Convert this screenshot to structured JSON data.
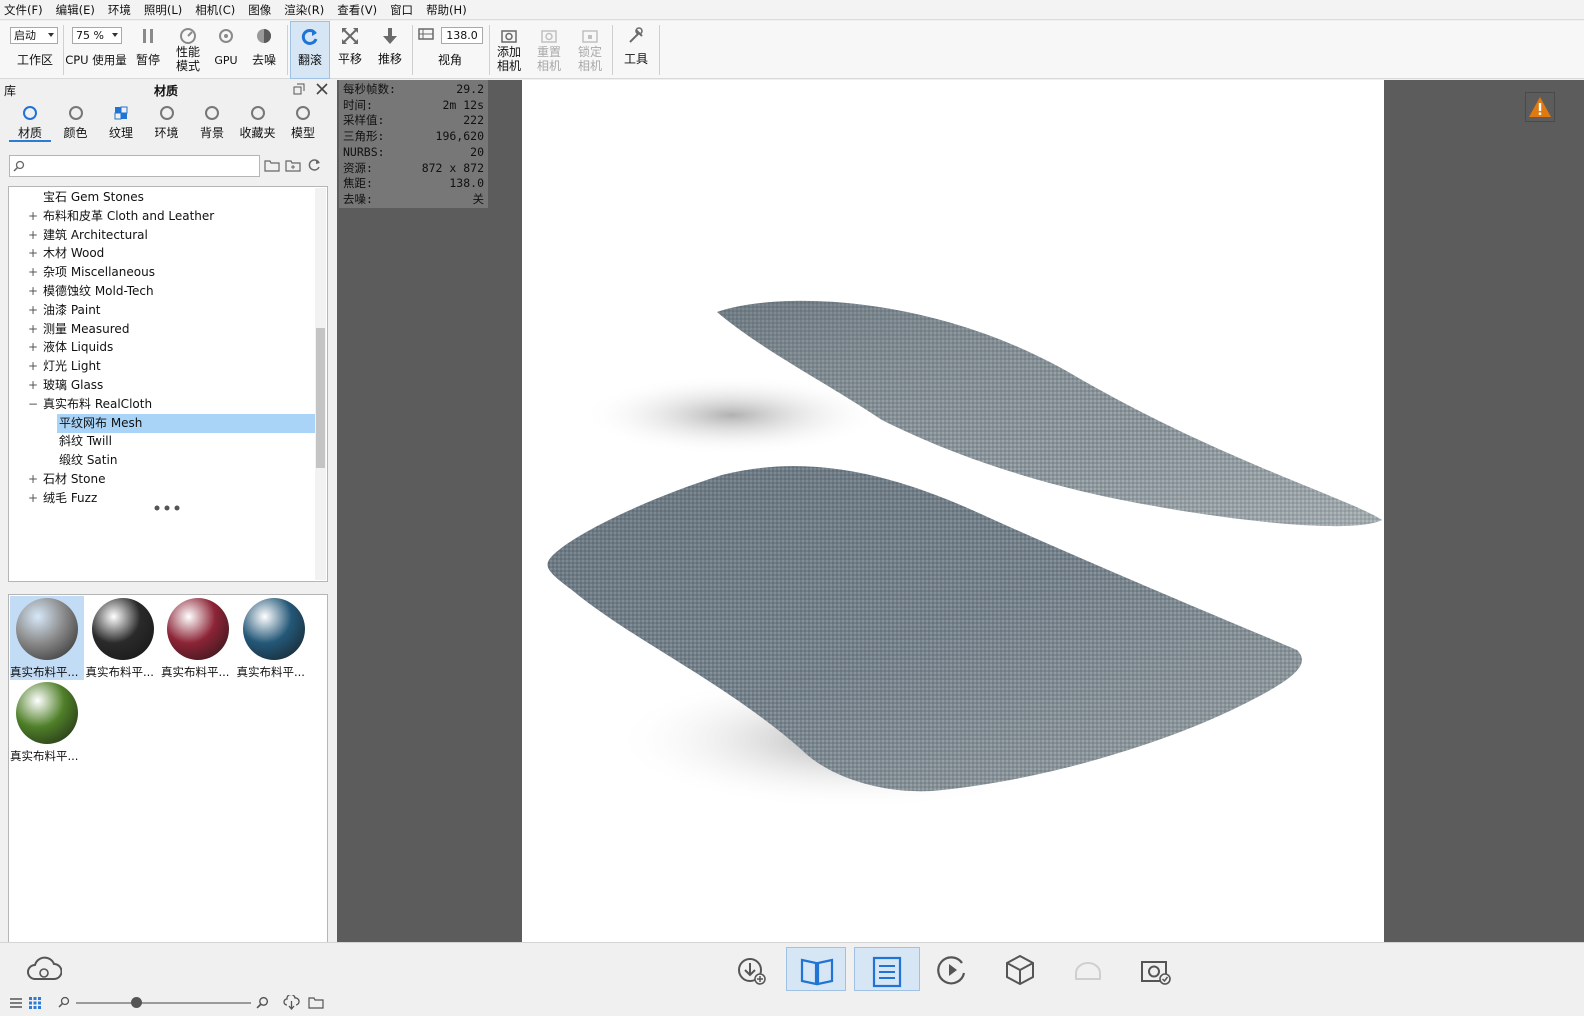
{
  "menubar": [
    "文件(F)",
    "编辑(E)",
    "环境",
    "照明(L)",
    "相机(C)",
    "图像",
    "渲染(R)",
    "查看(V)",
    "窗口",
    "帮助(H)"
  ],
  "toolbar": {
    "start_combo": "启动",
    "workspace_label": "工作区",
    "zoom_combo": "75 %",
    "cpu_usage_label": "CPU 使用量",
    "pause_label": "暂停",
    "perf_mode_label_1": "性能",
    "perf_mode_label_2": "模式",
    "gpu_label": "GPU",
    "denoise_label": "去噪",
    "tumble_label": "翻滚",
    "pan_label": "平移",
    "dolly_label": "推移",
    "fov_value": "138.0",
    "fov_label": "视角",
    "add_camera_1": "添加",
    "add_camera_2": "相机",
    "reset_camera_1": "重置",
    "reset_camera_2": "相机",
    "lock_camera_1": "锁定",
    "lock_camera_2": "相机",
    "tools_label": "工具"
  },
  "library": {
    "panel_title": "库",
    "panel_subtitle": "材质",
    "tabs": [
      {
        "label": "材质",
        "active": true
      },
      {
        "label": "颜色"
      },
      {
        "label": "纹理"
      },
      {
        "label": "环境"
      },
      {
        "label": "背景"
      },
      {
        "label": "收藏夹"
      },
      {
        "label": "模型"
      }
    ],
    "search_placeholder": "",
    "tree": [
      {
        "text": "宝石 Gem Stones",
        "exp": "",
        "level": 0
      },
      {
        "text": "布料和皮革 Cloth and Leather",
        "exp": "+",
        "level": 0
      },
      {
        "text": "建筑 Architectural",
        "exp": "+",
        "level": 0
      },
      {
        "text": "木材 Wood",
        "exp": "+",
        "level": 0
      },
      {
        "text": "杂项 Miscellaneous",
        "exp": "+",
        "level": 0
      },
      {
        "text": "模德蚀纹 Mold-Tech",
        "exp": "+",
        "level": 0
      },
      {
        "text": "油漆 Paint",
        "exp": "+",
        "level": 0
      },
      {
        "text": "测量 Measured",
        "exp": "+",
        "level": 0
      },
      {
        "text": "液体 Liquids",
        "exp": "+",
        "level": 0
      },
      {
        "text": "灯光 Light",
        "exp": "+",
        "level": 0
      },
      {
        "text": "玻璃 Glass",
        "exp": "+",
        "level": 0
      },
      {
        "text": "真实布料 RealCloth",
        "exp": "−",
        "level": 0
      },
      {
        "text": "平纹网布 Mesh",
        "exp": "",
        "level": 1,
        "selected": true
      },
      {
        "text": "斜纹 Twill",
        "exp": "",
        "level": 1
      },
      {
        "text": "缎纹 Satin",
        "exp": "",
        "level": 1
      },
      {
        "text": "石材 Stone",
        "exp": "+",
        "level": 0
      },
      {
        "text": "绒毛 Fuzz",
        "exp": "+",
        "level": 0
      }
    ],
    "thumbnails": [
      {
        "caption": "真实布料平...",
        "color": "#8a8a8a",
        "selected": true
      },
      {
        "caption": "真实布料平...",
        "color": "#2a2a2a"
      },
      {
        "caption": "真实布料平...",
        "color": "#8c2436"
      },
      {
        "caption": "真实布料平...",
        "color": "#245878"
      },
      {
        "caption": "真实布料平...",
        "color": "#4f7f28"
      }
    ]
  },
  "stats": [
    {
      "k": "每秒帧数:",
      "v": "29.2"
    },
    {
      "k": "时间:",
      "v": "2m 12s"
    },
    {
      "k": "采样值:",
      "v": "222"
    },
    {
      "k": "三角形:",
      "v": "196,620"
    },
    {
      "k": "NURBS:",
      "v": "20"
    },
    {
      "k": "资源:",
      "v": "872 x 872"
    },
    {
      "k": "焦距:",
      "v": "138.0"
    },
    {
      "k": "去噪:",
      "v": "关"
    }
  ],
  "colors": {
    "accent": "#2e7bd6",
    "warning": "#e07a10",
    "selection": "#a9d3f7"
  }
}
